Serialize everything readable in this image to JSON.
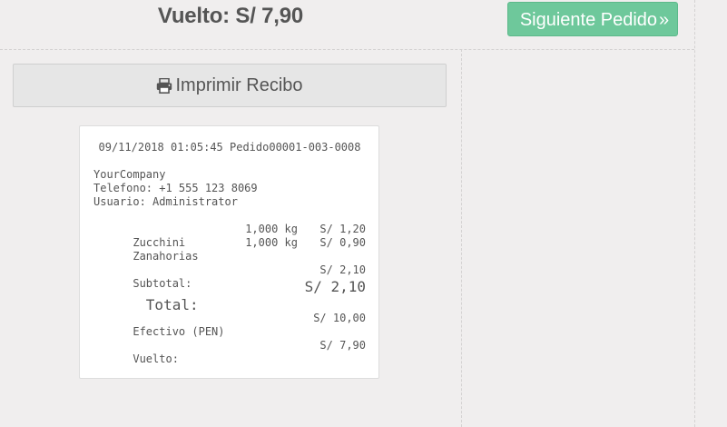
{
  "header": {
    "change_label": "Vuelto: S/ 7,90",
    "next_order_label": "Siguiente Pedido",
    "next_order_icon": "double-chevron-right-icon"
  },
  "print": {
    "label": "Imprimir Recibo",
    "icon": "printer-icon"
  },
  "receipt": {
    "header_line": "09/11/2018 01:05:45 Pedido00001-003-0008",
    "company": "YourCompany",
    "phone": "Telefono: +1 555 123 8069",
    "user": "Usuario: Administrator",
    "lines": [
      {
        "product": "Zucchini",
        "qty": "1,000 kg",
        "price": "S/ 1,20"
      },
      {
        "product": "Zanahorias",
        "qty": "1,000 kg",
        "price": "S/ 0,90"
      }
    ],
    "subtotal_label": "Subtotal:",
    "subtotal_value": "S/ 2,10",
    "total_label": "Total:",
    "total_value": "S/ 2,10",
    "payment_label": "Efectivo (PEN)",
    "payment_value": "S/ 10,00",
    "change_label": "Vuelto:",
    "change_value": "S/ 7,90"
  },
  "colors": {
    "background": "#f0eeee",
    "next_button": "#6ec89b",
    "print_button": "#e6e6e6",
    "text": "#555555"
  }
}
